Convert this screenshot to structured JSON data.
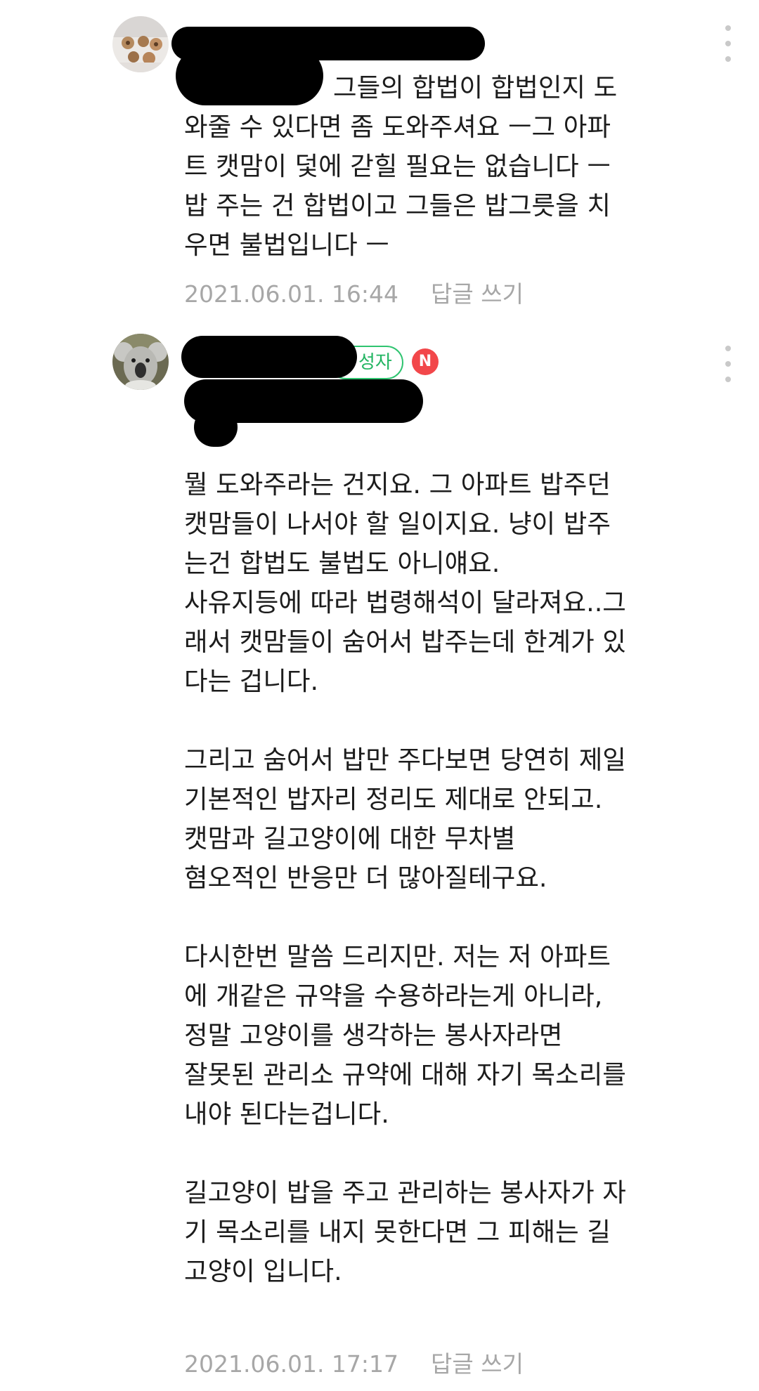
{
  "comments": [
    {
      "avatar": "cookie-avatar",
      "text": "그들의 합법이 합법인지 도\n와줄 수 있다면 좀 도와주셔요 ㅡ그 아파\n트 캣맘이 덫에 갇힐 필요는 없습니다 ㅡ\n밥 주는 건 합법이고 그들은 밥그릇을 치\n우면 불법입니다 ㅡ",
      "date": "2021.06.01. 16:44",
      "reply_label": "답글 쓰기"
    },
    {
      "avatar": "koala-avatar",
      "author_badge": "성자",
      "new_badge": "N",
      "text": "뭘 도와주라는 건지요. 그 아파트 밥주던\n캣맘들이 나서야 할 일이지요. 냥이 밥주\n는건 합법도 불법도 아니얘요.\n사유지등에 따라 법령해석이 달라져요..그\n래서 캣맘들이 숨어서 밥주는데 한계가 있\n다는 겁니다.\n\n그리고 숨어서 밥만 주다보면 당연히 제일\n기본적인 밥자리 정리도 제대로 안되고.\n캣맘과 길고양이에 대한 무차별\n혐오적인 반응만 더 많아질테구요.\n\n다시한번 말씀 드리지만. 저는 저 아파트\n에 개같은 규약을 수용하라는게 아니라,\n정말 고양이를 생각하는 봉사자라면\n잘못된 관리소 규약에 대해 자기 목소리를\n내야 된다는겁니다.\n\n길고양이 밥을 주고 관리하는 봉사자가 자\n기 목소리를 내지 못한다면 그 피해는 길\n고양이 입니다.",
      "date": "2021.06.01. 17:17",
      "reply_label": "답글 쓰기"
    }
  ],
  "colors": {
    "meta_text": "#a7a7a7",
    "badge_green": "#2fc470",
    "new_red": "#f2474a",
    "more_dots": "#c9c9c9"
  }
}
